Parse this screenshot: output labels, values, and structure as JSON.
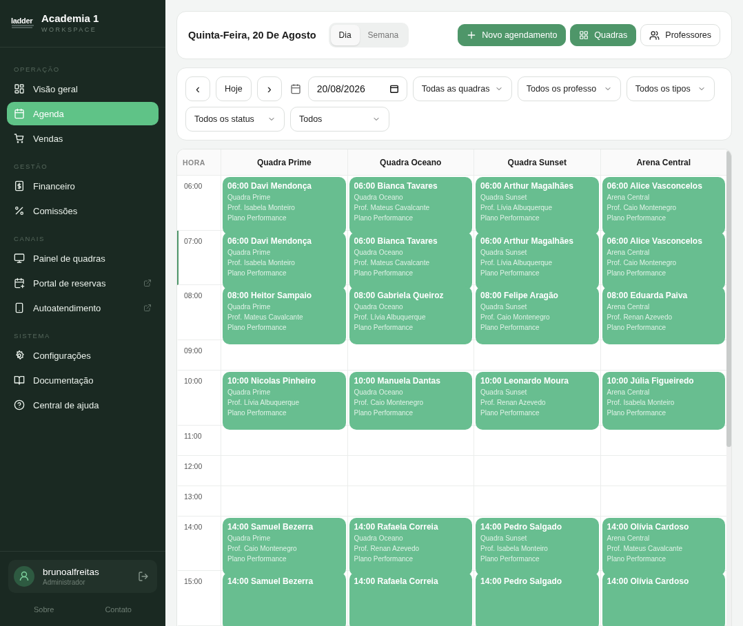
{
  "sidebar": {
    "logo": "ladder",
    "workspace": "Academia 1",
    "workspace_label": "WORKSPACE",
    "sections": [
      {
        "title": "OPERAÇÃO",
        "items": [
          {
            "label": "Visão geral",
            "selected": false
          },
          {
            "label": "Agenda",
            "selected": true
          },
          {
            "label": "Vendas",
            "selected": false
          }
        ]
      },
      {
        "title": "GESTÃO",
        "items": [
          {
            "label": "Financeiro",
            "selected": false
          },
          {
            "label": "Comissões",
            "selected": false
          }
        ]
      },
      {
        "title": "CANAIS",
        "items": [
          {
            "label": "Painel de quadras",
            "selected": false
          },
          {
            "label": "Portal de reservas",
            "selected": false,
            "external": true
          },
          {
            "label": "Autoatendimento",
            "selected": false,
            "external": true
          }
        ]
      },
      {
        "title": "SISTEMA",
        "items": [
          {
            "label": "Configurações",
            "selected": false
          },
          {
            "label": "Documentação",
            "selected": false
          },
          {
            "label": "Central de ajuda",
            "selected": false
          }
        ]
      }
    ],
    "user": {
      "name": "brunoalfreitas",
      "role": "Administrador"
    },
    "footer_links": [
      "Sobre",
      "Contato"
    ]
  },
  "header": {
    "date_title": "Quinta-Feira, 20 De Agosto",
    "modes": [
      {
        "label": "Dia",
        "selected": true
      },
      {
        "label": "Semana",
        "selected": false
      }
    ],
    "actions": [
      {
        "kind": "new",
        "label": "Novo agendamento"
      },
      {
        "kind": "view",
        "label": "Quadras",
        "selected": true
      },
      {
        "kind": "view",
        "label": "Professores",
        "selected": false
      }
    ]
  },
  "filters": {
    "prev": "‹",
    "today": "Hoje",
    "next": "›",
    "date": "20/08/2026",
    "selects": [
      "Todas as quadras",
      "Todos os professo",
      "Todos os tipos",
      "Todos os status",
      "Todos"
    ]
  },
  "schedule": {
    "time_heading": "HORA",
    "columns": [
      "Quadra Prime",
      "Quadra Oceano",
      "Quadra Sunset",
      "Arena Central"
    ],
    "rows": [
      {
        "time": "06:00",
        "current": false,
        "bookings": [
          {
            "title": "06:00 Davi Mendonça",
            "court": "Quadra Prime",
            "teacher": "Prof. Isabela Monteiro",
            "plan": "Plano Performance"
          },
          {
            "title": "06:00 Bianca Tavares",
            "court": "Quadra Oceano",
            "teacher": "Prof. Mateus Cavalcante",
            "plan": "Plano Performance"
          },
          {
            "title": "06:00 Arthur Magalhães",
            "court": "Quadra Sunset",
            "teacher": "Prof. Lívia Albuquerque",
            "plan": "Plano Performance"
          },
          {
            "title": "06:00 Alice Vasconcelos",
            "court": "Arena Central",
            "teacher": "Prof. Caio Montenegro",
            "plan": "Plano Performance"
          }
        ]
      },
      {
        "time": "07:00",
        "current": true,
        "bookings": [
          {
            "title": "06:00 Davi Mendonça",
            "court": "Quadra Prime",
            "teacher": "Prof. Isabela Monteiro",
            "plan": "Plano Performance"
          },
          {
            "title": "06:00 Bianca Tavares",
            "court": "Quadra Oceano",
            "teacher": "Prof. Mateus Cavalcante",
            "plan": "Plano Performance"
          },
          {
            "title": "06:00 Arthur Magalhães",
            "court": "Quadra Sunset",
            "teacher": "Prof. Lívia Albuquerque",
            "plan": "Plano Performance"
          },
          {
            "title": "06:00 Alice Vasconcelos",
            "court": "Arena Central",
            "teacher": "Prof. Caio Montenegro",
            "plan": "Plano Performance"
          }
        ]
      },
      {
        "time": "08:00",
        "current": false,
        "bookings": [
          {
            "title": "08:00 Heitor Sampaio",
            "court": "Quadra Prime",
            "teacher": "Prof. Mateus Cavalcante",
            "plan": "Plano Performance"
          },
          {
            "title": "08:00 Gabriela Queiroz",
            "court": "Quadra Oceano",
            "teacher": "Prof. Lívia Albuquerque",
            "plan": "Plano Performance"
          },
          {
            "title": "08:00 Felipe Aragão",
            "court": "Quadra Sunset",
            "teacher": "Prof. Caio Montenegro",
            "plan": "Plano Performance"
          },
          {
            "title": "08:00 Eduarda Paiva",
            "court": "Arena Central",
            "teacher": "Prof. Renan Azevedo",
            "plan": "Plano Performance"
          }
        ]
      },
      {
        "time": "09:00",
        "current": false
      },
      {
        "time": "10:00",
        "current": false,
        "bookings": [
          {
            "title": "10:00 Nicolas Pinheiro",
            "court": "Quadra Prime",
            "teacher": "Prof. Lívia Albuquerque",
            "plan": "Plano Performance"
          },
          {
            "title": "10:00 Manuela Dantas",
            "court": "Quadra Oceano",
            "teacher": "Prof. Caio Montenegro",
            "plan": "Plano Performance"
          },
          {
            "title": "10:00 Leonardo Moura",
            "court": "Quadra Sunset",
            "teacher": "Prof. Renan Azevedo",
            "plan": "Plano Performance"
          },
          {
            "title": "10:00 Júlia Figueiredo",
            "court": "Arena Central",
            "teacher": "Prof. Isabela Monteiro",
            "plan": "Plano Performance"
          }
        ]
      },
      {
        "time": "11:00",
        "current": false
      },
      {
        "time": "12:00",
        "current": false
      },
      {
        "time": "13:00",
        "current": false
      },
      {
        "time": "14:00",
        "current": false,
        "bookings": [
          {
            "title": "14:00 Samuel Bezerra",
            "court": "Quadra Prime",
            "teacher": "Prof. Caio Montenegro",
            "plan": "Plano Performance"
          },
          {
            "title": "14:00 Rafaela Correia",
            "court": "Quadra Oceano",
            "teacher": "Prof. Renan Azevedo",
            "plan": "Plano Performance"
          },
          {
            "title": "14:00 Pedro Salgado",
            "court": "Quadra Sunset",
            "teacher": "Prof. Isabela Monteiro",
            "plan": "Plano Performance"
          },
          {
            "title": "14:00 Olívia Cardoso",
            "court": "Arena Central",
            "teacher": "Prof. Mateus Cavalcante",
            "plan": "Plano Performance"
          }
        ]
      },
      {
        "time": "15:00",
        "current": false,
        "bookings": [
          {
            "title": "14:00 Samuel Bezerra"
          },
          {
            "title": "14:00 Rafaela Correia"
          },
          {
            "title": "14:00 Pedro Salgado"
          },
          {
            "title": "14:00 Olívia Cardoso"
          }
        ]
      }
    ]
  }
}
